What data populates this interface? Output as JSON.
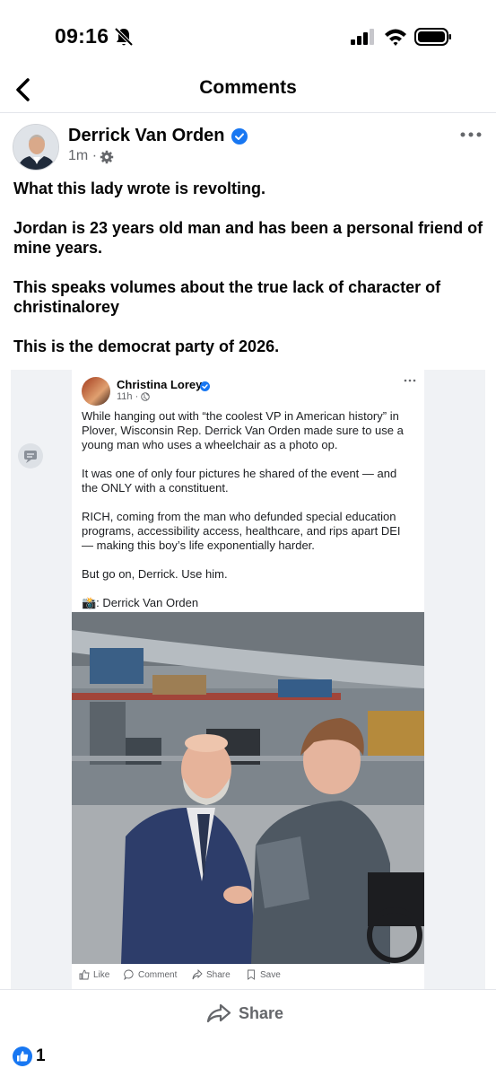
{
  "status_bar": {
    "time": "09:16",
    "icons": [
      "bell-slash-icon",
      "signal-icon",
      "wifi-icon",
      "battery-icon"
    ]
  },
  "nav": {
    "title": "Comments",
    "back_icon": "chevron-left-icon"
  },
  "post": {
    "author": "Derrick Van Orden",
    "verified": true,
    "time": "1m",
    "separator": "·",
    "privacy_icon": "gear-icon",
    "paragraphs": [
      "What this lady wrote is revolting.",
      "Jordan is 23 years old man and has been a personal friend of mine years.",
      "This speaks volumes about the true lack of character of christinalorey",
      "This is the democrat party of 2026."
    ]
  },
  "embedded_post": {
    "author": "Christina Lorey",
    "verified": true,
    "time": "11h",
    "separator": "·",
    "paragraphs": [
      "While hanging out with “the coolest VP in American history” in Plover, Wisconsin Rep. Derrick Van Orden made sure to use a young man who uses a wheelchair as a photo op.",
      "It was one of only four pictures he shared of the event — and the ONLY with a constituent.",
      "RICH, coming from the man who defunded special education programs, accessibility access, healthcare, and rips apart DEI — making this boy’s life exponentially harder.",
      "But go on, Derrick. Use him.",
      "📸: Derrick Van Orden"
    ],
    "actions": [
      "Like",
      "Comment",
      "Share",
      "Save"
    ]
  },
  "share": {
    "label": "Share"
  },
  "reactions": {
    "count": "1"
  },
  "colors": {
    "verified": "#1877f2",
    "like": "#1877f2",
    "muted": "#65676b",
    "divider": "#e4e6eb"
  }
}
